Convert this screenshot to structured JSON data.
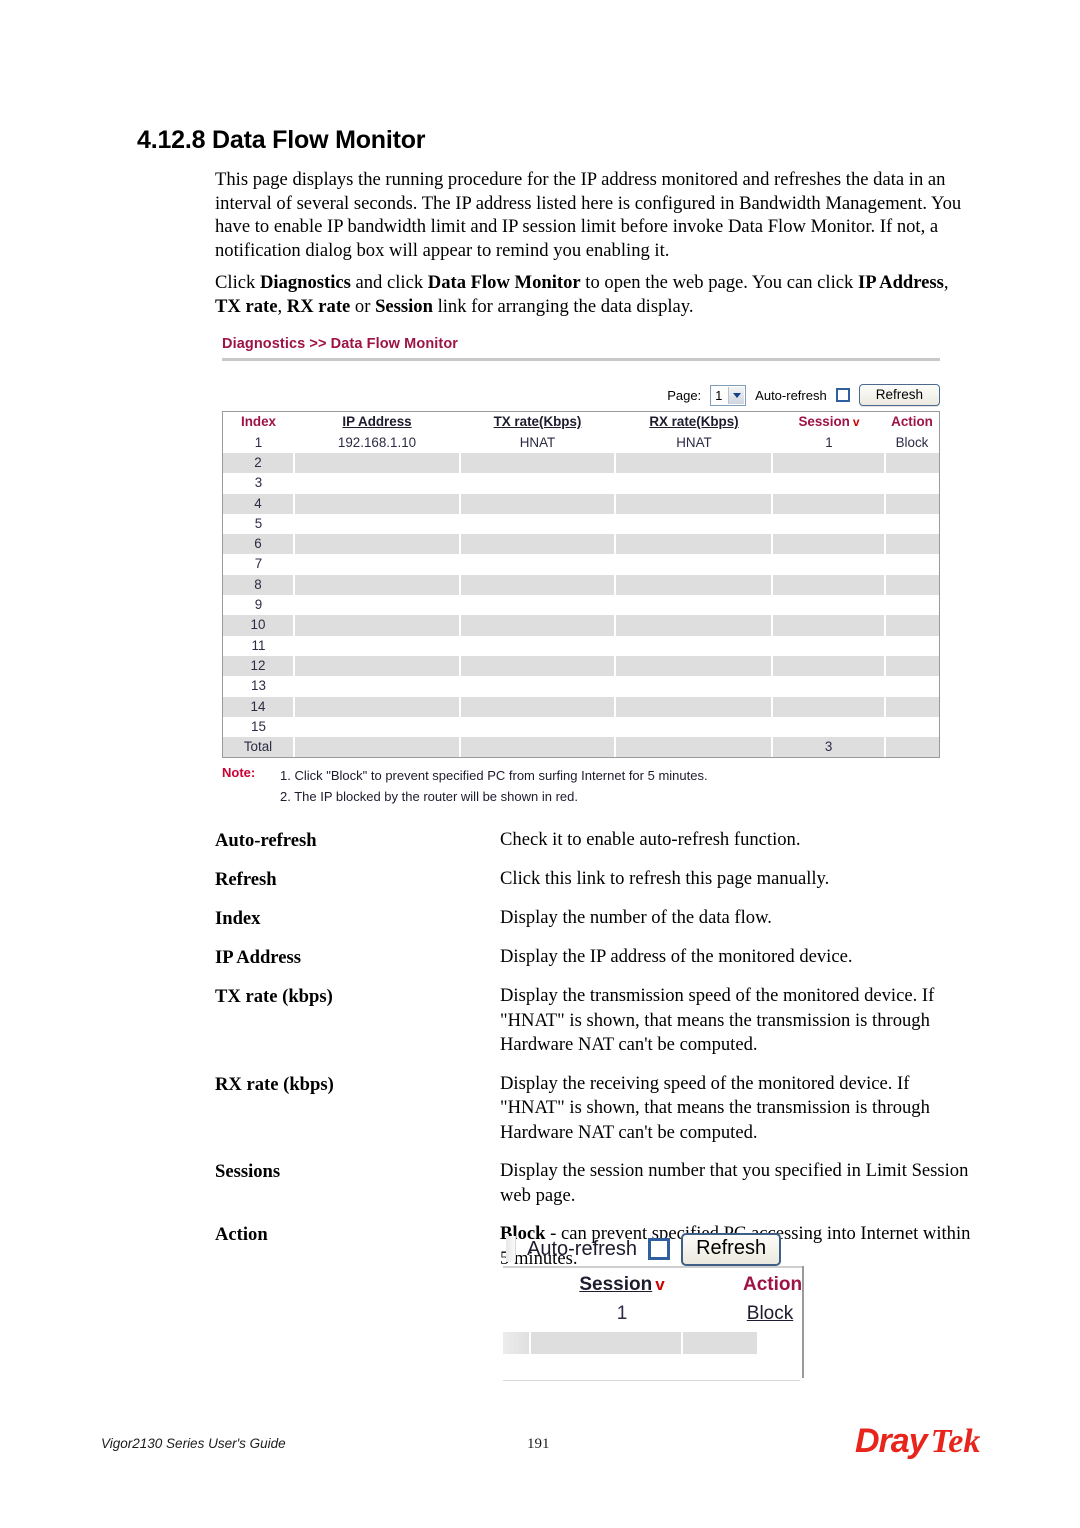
{
  "section": {
    "number": "4.12.8",
    "title": "Data Flow Monitor",
    "heading": "4.12.8 Data Flow Monitor"
  },
  "paragraphs": {
    "p1": "This page displays the running procedure for the IP address monitored and refreshes the data in an interval of several seconds. The IP address listed here is configured in Bandwidth Management. You have to enable IP bandwidth limit and IP session limit before invoke Data Flow Monitor. If not, a notification dialog box will appear to remind you enabling it."
  },
  "screenshot": {
    "breadcrumb": "Diagnostics >> Data Flow Monitor",
    "toolbar": {
      "page_label": "Page:",
      "page_value": "1",
      "autorefresh_label": "Auto-refresh",
      "autorefresh_checked": false,
      "refresh_label": "Refresh"
    },
    "table": {
      "columns": [
        "Index",
        "IP Address",
        "TX rate(Kbps)",
        "RX rate(Kbps)",
        "Session",
        "Action"
      ],
      "sort_indicator_column": "Session",
      "sort_indicator": "v",
      "rows": [
        {
          "index": "1",
          "ip": "192.168.1.10",
          "tx": "HNAT",
          "rx": "HNAT",
          "session": "1",
          "action": "Block",
          "shaded": false
        },
        {
          "index": "2",
          "ip": "",
          "tx": "",
          "rx": "",
          "session": "",
          "action": "",
          "shaded": true
        },
        {
          "index": "3",
          "ip": "",
          "tx": "",
          "rx": "",
          "session": "",
          "action": "",
          "shaded": false
        },
        {
          "index": "4",
          "ip": "",
          "tx": "",
          "rx": "",
          "session": "",
          "action": "",
          "shaded": true
        },
        {
          "index": "5",
          "ip": "",
          "tx": "",
          "rx": "",
          "session": "",
          "action": "",
          "shaded": false
        },
        {
          "index": "6",
          "ip": "",
          "tx": "",
          "rx": "",
          "session": "",
          "action": "",
          "shaded": true
        },
        {
          "index": "7",
          "ip": "",
          "tx": "",
          "rx": "",
          "session": "",
          "action": "",
          "shaded": false
        },
        {
          "index": "8",
          "ip": "",
          "tx": "",
          "rx": "",
          "session": "",
          "action": "",
          "shaded": true
        },
        {
          "index": "9",
          "ip": "",
          "tx": "",
          "rx": "",
          "session": "",
          "action": "",
          "shaded": false
        },
        {
          "index": "10",
          "ip": "",
          "tx": "",
          "rx": "",
          "session": "",
          "action": "",
          "shaded": true
        },
        {
          "index": "11",
          "ip": "",
          "tx": "",
          "rx": "",
          "session": "",
          "action": "",
          "shaded": false
        },
        {
          "index": "12",
          "ip": "",
          "tx": "",
          "rx": "",
          "session": "",
          "action": "",
          "shaded": true
        },
        {
          "index": "13",
          "ip": "",
          "tx": "",
          "rx": "",
          "session": "",
          "action": "",
          "shaded": false
        },
        {
          "index": "14",
          "ip": "",
          "tx": "",
          "rx": "",
          "session": "",
          "action": "",
          "shaded": true
        },
        {
          "index": "15",
          "ip": "",
          "tx": "",
          "rx": "",
          "session": "",
          "action": "",
          "shaded": false
        }
      ],
      "total_row": {
        "index": "Total",
        "ip": "",
        "tx": "",
        "rx": "",
        "session": "3",
        "action": ""
      }
    },
    "note": {
      "label": "Note:",
      "line1": "1. Click \"Block\" to prevent specified PC from surfing Internet for 5 minutes.",
      "line2": "2. The IP blocked by the router will be shown in red."
    }
  },
  "definitions": [
    {
      "term": "Auto-refresh",
      "desc": "Check it to enable auto-refresh function."
    },
    {
      "term": "Refresh",
      "desc": "Click this link to refresh this page manually."
    },
    {
      "term": "Index",
      "desc": "Display the number of the data flow."
    },
    {
      "term": "IP Address",
      "desc": "Display the IP address of the monitored device."
    },
    {
      "term": "TX rate (kbps)",
      "desc": "Display the transmission speed of the monitored device. If \"HNAT\" is shown, that means the transmission is through Hardware NAT can't be computed."
    },
    {
      "term": "RX rate (kbps)",
      "desc": "Display the receiving speed of the monitored device. If \"HNAT\" is shown, that means the transmission is through Hardware NAT can't be computed."
    },
    {
      "term": "Sessions",
      "desc": "Display the session number that you specified in Limit Session web page."
    },
    {
      "term": "Action",
      "desc": ""
    }
  ],
  "inset": {
    "autorefresh_label": "Auto-refresh",
    "refresh_label": "Refresh",
    "session_header": "Session",
    "action_header": "Action",
    "sort_indicator": "v",
    "session_value": "1",
    "action_value": "Block"
  },
  "footer": {
    "left": "Vigor2130 Series User's Guide",
    "page_number": "191",
    "logo_first": "Dray",
    "logo_second": "Tek"
  },
  "colors": {
    "brand_red": "#e8251c",
    "heading_maroon": "#9e1345",
    "note_red": "#cc0033",
    "row_shade": "#dedede",
    "link_navy": "#1c1c2e"
  }
}
